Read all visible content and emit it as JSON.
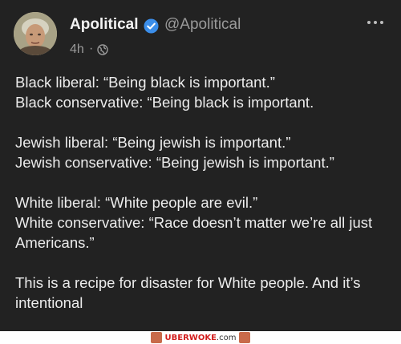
{
  "post": {
    "author": {
      "name": "Apolitical",
      "handle": "@Apolitical",
      "verified": true
    },
    "time": "4h",
    "separator": "·",
    "paragraphs": [
      [
        "Black liberal: “Being black is important.”",
        "Black conservative: “Being black is important."
      ],
      [
        "Jewish liberal: “Being jewish is important.”",
        "Jewish conservative: “Being jewish is important.”"
      ],
      [
        "White liberal: “White people are evil.”",
        "White conservative: “Race doesn’t matter we’re all just Americans.”"
      ],
      [
        "This is a recipe for disaster for White people. And it’s intentional"
      ]
    ]
  },
  "watermark": {
    "brand": "UBERWOKE",
    "suffix": ".com"
  },
  "colors": {
    "background": "#222222",
    "text": "#ececec",
    "muted": "#9a9a9a",
    "verified": "#3b8eea"
  },
  "icons": [
    "verified-badge-icon",
    "globe-icon",
    "more-options-icon"
  ]
}
